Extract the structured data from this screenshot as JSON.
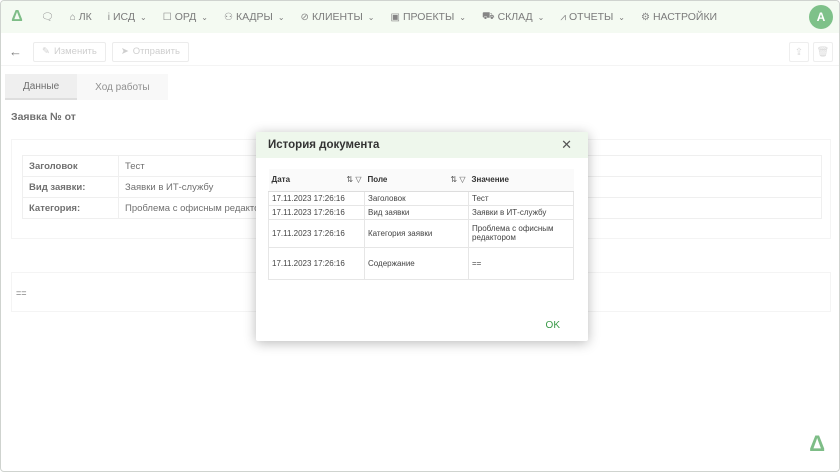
{
  "nav": {
    "logo": "Δ",
    "items": [
      {
        "icon": "🗨",
        "label": "",
        "chev": ""
      },
      {
        "icon": "⌂",
        "label": "ЛК",
        "chev": ""
      },
      {
        "icon": "i",
        "label": "ИСД",
        "chev": "⌄"
      },
      {
        "icon": "☐",
        "label": "ОРД",
        "chev": "⌄"
      },
      {
        "icon": "⚇",
        "label": "КАДРЫ",
        "chev": "⌄"
      },
      {
        "icon": "⊘",
        "label": "КЛИЕНТЫ",
        "chev": "⌄"
      },
      {
        "icon": "▣",
        "label": "ПРОЕКТЫ",
        "chev": "⌄"
      },
      {
        "icon": "⛟",
        "label": "СКЛАД",
        "chev": "⌄"
      },
      {
        "icon": "⩘",
        "label": "ОТЧЕТЫ",
        "chev": "⌄"
      },
      {
        "icon": "⚙",
        "label": "НАСТРОЙКИ",
        "chev": ""
      }
    ],
    "avatar": "А"
  },
  "toolbar": {
    "back": "←",
    "edit": "Изменить",
    "send": "Отправить"
  },
  "tabs": [
    "Данные",
    "Ход работы"
  ],
  "doc_title": "Заявка № от",
  "fields": [
    {
      "key": "Заголовок",
      "value": "Тест"
    },
    {
      "key": "Вид заявки:",
      "value": "Заявки в ИТ-службу"
    },
    {
      "key": "Категория:",
      "value": "Проблема с офисным редакто"
    }
  ],
  "content_value": "==",
  "modal": {
    "title": "История документа",
    "close": "✕",
    "headers": [
      "Дата",
      "Поле",
      "Значение"
    ],
    "rows": [
      {
        "date": "17.11.2023 17:26:16",
        "field": "Заголовок",
        "value": "Тест"
      },
      {
        "date": "17.11.2023 17:26:16",
        "field": "Вид заявки",
        "value": "Заявки в ИТ-службу"
      },
      {
        "date": "17.11.2023 17:26:16",
        "field": "Категория заявки",
        "value": "Проблема с офисным редактором"
      },
      {
        "date": "17.11.2023 17:26:16",
        "field": "Содержание",
        "value": "=="
      }
    ],
    "ok": "OK"
  },
  "colors": {
    "accent": "#3a9a48",
    "header_bg": "#eef7ec"
  }
}
